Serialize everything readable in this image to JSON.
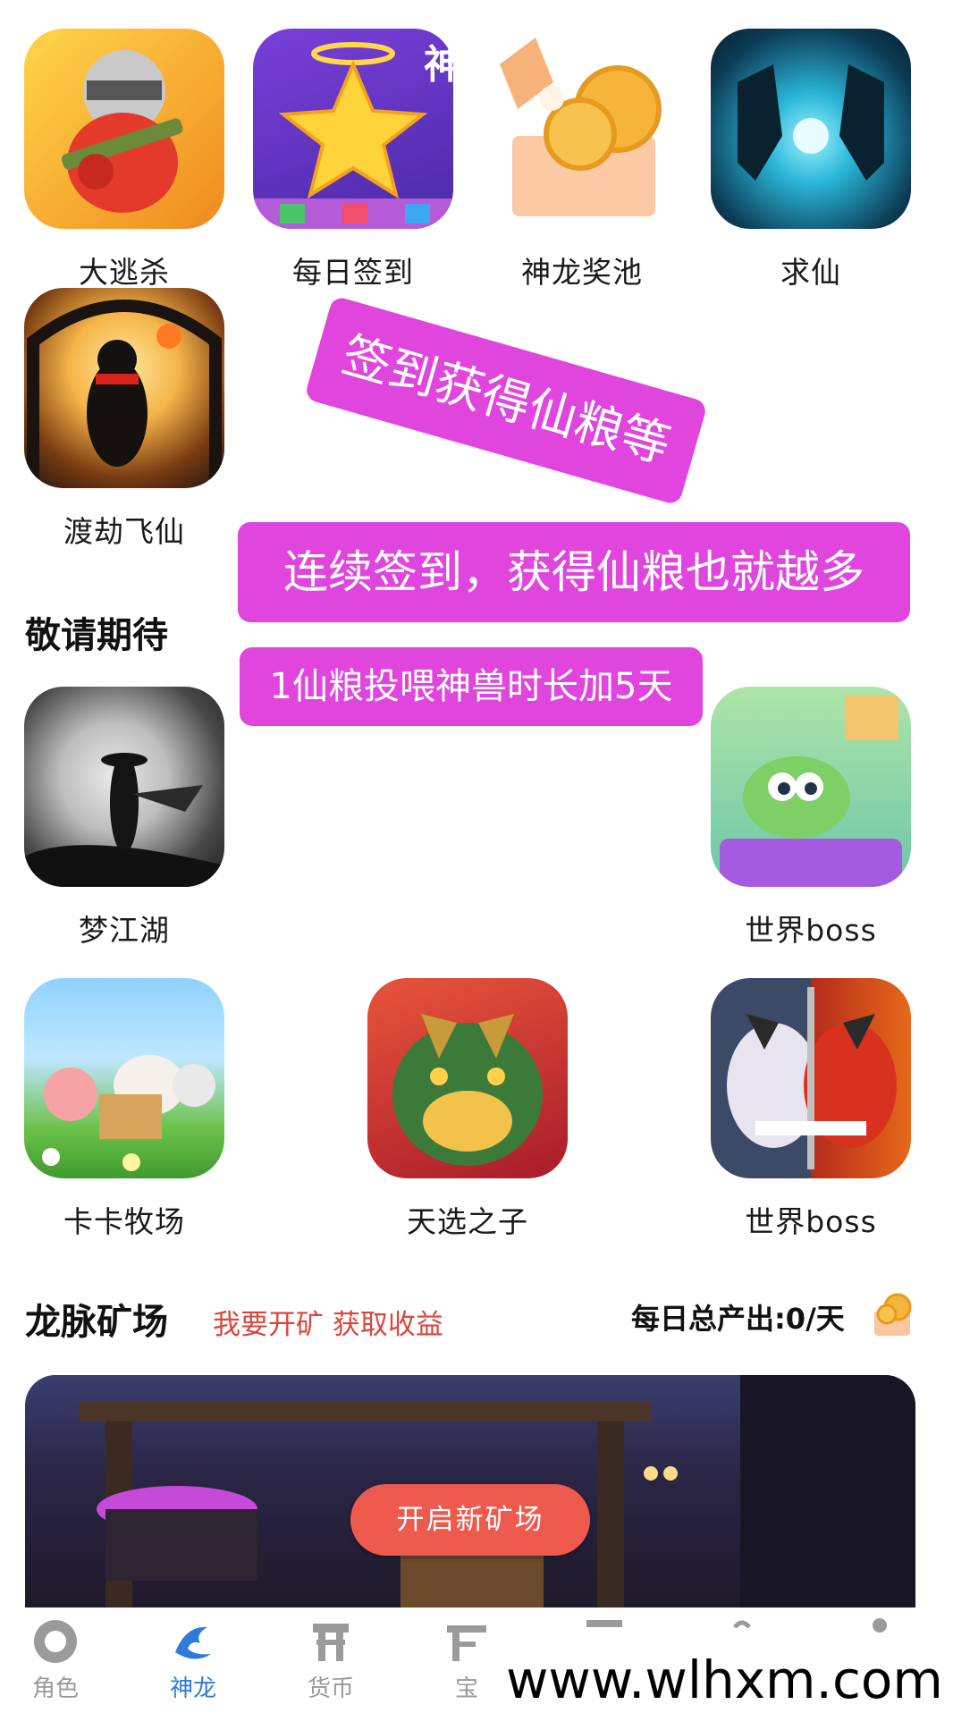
{
  "top_overlay_text": "神龙",
  "games_row1": [
    {
      "label": "大逃杀",
      "icon": "battle-royale-icon"
    },
    {
      "label": "每日签到",
      "icon": "star-checkin-icon"
    },
    {
      "label": "神龙奖池",
      "icon": "coin-jackpot-icon"
    },
    {
      "label": "求仙",
      "icon": "immortal-quest-icon"
    }
  ],
  "games_row2": [
    {
      "label": "渡劫飞仙",
      "icon": "tribulation-icon"
    }
  ],
  "promos": {
    "tilted": "签到获得仙粮等",
    "wide": "连续签到，获得仙粮也就越多",
    "small": "1仙粮投喂神兽时长加5天"
  },
  "coming_soon": {
    "title": "敬请期待",
    "row1": [
      {
        "label": "梦江湖",
        "icon": "swordsman-moon-icon"
      },
      {
        "label": "世界boss",
        "icon": "puzzle-tank-icon"
      }
    ],
    "row2": [
      {
        "label": "卡卡牧场",
        "icon": "farm-animals-icon"
      },
      {
        "label": "天选之子",
        "icon": "dragon-beast-icon"
      },
      {
        "label": "世界boss",
        "icon": "demon-mask-icon"
      }
    ]
  },
  "mine": {
    "title": "龙脉矿场",
    "subtitle": "我要开矿 获取收益",
    "daily_output_label": "每日总产出:0/天",
    "button_label": "开启新矿场"
  },
  "tabs": [
    {
      "label": "角色",
      "icon": "character-icon",
      "active": false
    },
    {
      "label": "神龙",
      "icon": "dragon-icon",
      "active": true
    },
    {
      "label": "货币",
      "icon": "currency-icon",
      "active": false
    },
    {
      "label": "宝",
      "icon": "treasure-icon",
      "active": false
    },
    {
      "label": "",
      "icon": "tab5-icon",
      "active": false
    },
    {
      "label": "",
      "icon": "tab6-icon",
      "active": false
    },
    {
      "label": "",
      "icon": "tab7-icon",
      "active": false
    }
  ],
  "watermark": "www.wlhxm.com",
  "colors": {
    "promo": "#e046de",
    "mine_subtitle": "#d9473a",
    "mine_button": "#ee5a4d",
    "tab_active": "#2f7bd9",
    "tab_inactive": "#9a9a9a"
  }
}
